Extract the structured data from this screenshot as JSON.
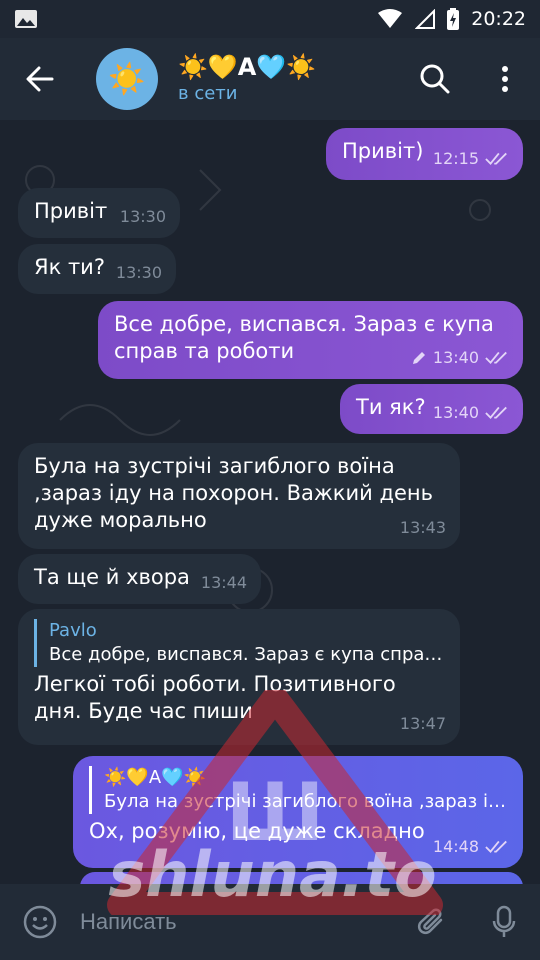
{
  "status_bar": {
    "time": "20:22"
  },
  "header": {
    "avatar_emoji": "☀️",
    "title": "☀️💛А🩵☀️",
    "status": "в сети",
    "accent_color": "#6cb3e5"
  },
  "messages": [
    {
      "dir": "out",
      "text": "Привіт)",
      "time": "12:15",
      "read": true
    },
    {
      "dir": "in",
      "text": "Привіт",
      "time": "13:30"
    },
    {
      "dir": "in",
      "text": "Як ти?",
      "time": "13:30"
    },
    {
      "dir": "out",
      "text": "Все добре, виспався. Зараз є купа справ та роботи",
      "time": "13:40",
      "edited": true,
      "read": true
    },
    {
      "dir": "out",
      "text": "Ти як?",
      "time": "13:40",
      "read": true
    },
    {
      "dir": "in",
      "text": "Була на зустрічі загиблого воїна ,зараз іду на похорон. Важкий день дуже морально",
      "time": "13:43"
    },
    {
      "dir": "in",
      "text": "Та ще й хвора",
      "time": "13:44"
    },
    {
      "dir": "in",
      "reply_author": "Pavlo",
      "reply_text": "Все добре, виспався. Зараз є купа спра…",
      "text": "Легкої тобі роботи. Позитивного дня. Буде час пиши",
      "time": "13:47"
    },
    {
      "dir": "out",
      "reply_author": "☀️💛А🩵☀️",
      "reply_text": "Була на зустрічі загиблого воїна ,зараз і…",
      "text": "Ох, розумію, це дуже складно",
      "time": "14:48",
      "read": true
    }
  ],
  "input": {
    "placeholder": "Написать"
  },
  "watermark": {
    "letter": "Ш",
    "text": "shluna.to"
  }
}
